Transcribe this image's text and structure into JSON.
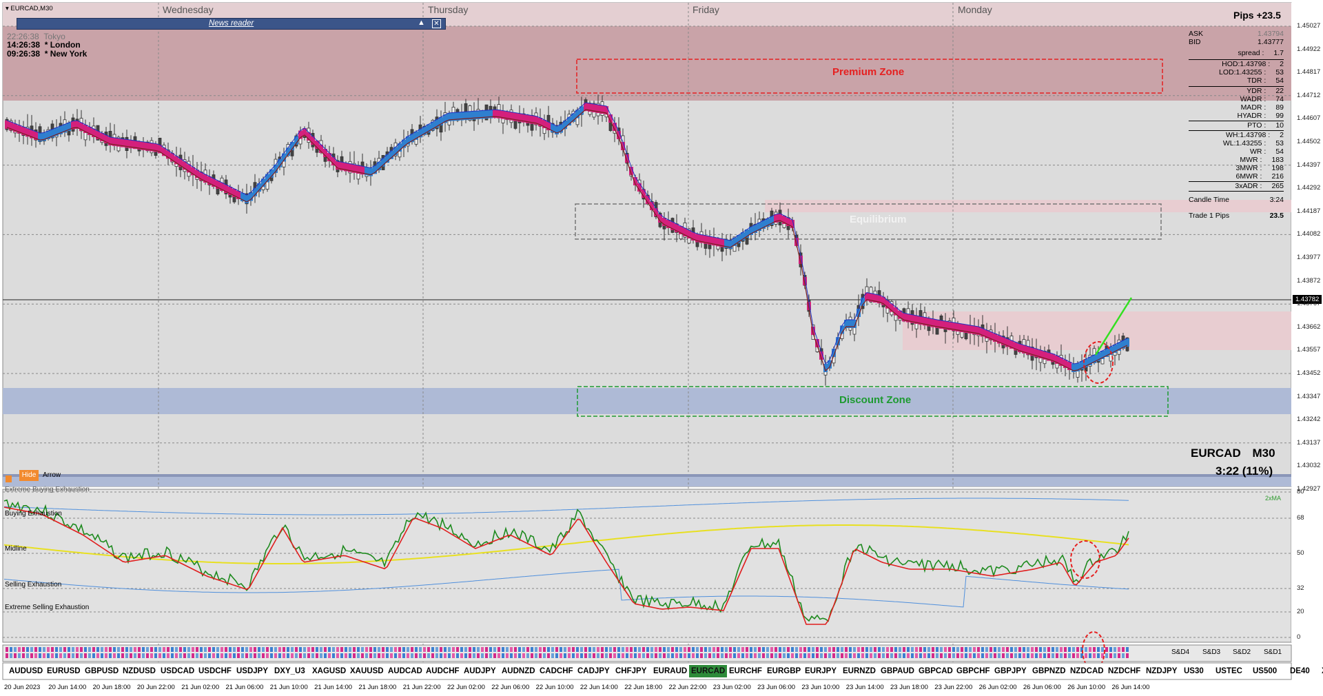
{
  "window": {
    "title": "EURCAD,M30"
  },
  "days": [
    "Wednesday",
    "Thursday",
    "Friday",
    "Monday"
  ],
  "news": {
    "title": "News reader"
  },
  "sessions": [
    {
      "time": "22:26:38",
      "name": "Tokyo"
    },
    {
      "time": "14:26:38",
      "name": "* London"
    },
    {
      "time": "09:26:38",
      "name": "* New York"
    }
  ],
  "zones": {
    "premium": "Premium Zone",
    "equilibrium": "Equilibrium",
    "discount": "Discount Zone"
  },
  "pips": "Pips +23.5",
  "panel": {
    "ask_label": "ASK",
    "ask": "1.43794",
    "bid_label": "BID",
    "bid": "1.43777",
    "spread_label": "spread :",
    "spread": "1.7",
    "hod_label": "HOD:1.43798 :",
    "hod": "2",
    "lod_label": "LOD:1.43255 :",
    "lod": "53",
    "tdr_label": "TDR :",
    "tdr": "54",
    "ydr_label": "YDR :",
    "ydr": "22",
    "wadr_label": "WADR :",
    "wadr": "74",
    "madr_label": "MADR :",
    "madr": "89",
    "hyadr_label": "HYADR :",
    "hyadr": "99",
    "pto_label": "PTO :",
    "pto": "10",
    "wh_label": "WH:1.43798 :",
    "wh": "2",
    "wl_label": "WL:1.43255 :",
    "wl": "53",
    "wr_label": "WR :",
    "wr": "54",
    "mwr_label": "MWR :",
    "mwr": "183",
    "mwr3_label": "3MWR :",
    "mwr3": "198",
    "mwr6_label": "6MWR :",
    "mwr6": "216",
    "adr3_label": "3xADR :",
    "adr3": "265",
    "candle_label": "Candle Time",
    "candle": "3:24",
    "trade_label": "Trade 1 Pips",
    "trade": "23.5"
  },
  "symbol_info": {
    "pair": "EURCAD",
    "tf": "M30",
    "timer": "3:22 (11%)"
  },
  "buttons": {
    "hide": "Hide",
    "arrow": "Arrow"
  },
  "price_axis": [
    "1.45027",
    "1.44922",
    "1.44817",
    "1.44712",
    "1.44607",
    "1.44502",
    "1.44397",
    "1.44292",
    "1.44187",
    "1.44082",
    "1.43977",
    "1.43872",
    "1.43767",
    "1.43662",
    "1.43557",
    "1.43452",
    "1.43347",
    "1.43242",
    "1.43137",
    "1.43032",
    "1.42927"
  ],
  "current_price": "1.43782",
  "oscillator": {
    "labels": [
      "Extreme Buying Exhaustion",
      "Buying Exhaustion",
      "Midline",
      "Selling Exhaustion",
      "Extreme Selling Exhaustion"
    ],
    "ma_label": "2xMA",
    "axis": [
      "80",
      "68",
      "50",
      "32",
      "20",
      "0"
    ]
  },
  "sd_labels": [
    "S&D4",
    "S&D3",
    "S&D2",
    "S&D1"
  ],
  "symbols": [
    "AUDUSD",
    "EURUSD",
    "GBPUSD",
    "NZDUSD",
    "USDCAD",
    "USDCHF",
    "USDJPY",
    "DXY_U3",
    "XAGUSD",
    "XAUUSD",
    "AUDCAD",
    "AUDCHF",
    "AUDJPY",
    "AUDNZD",
    "CADCHF",
    "CADJPY",
    "CHFJPY",
    "EURAUD",
    "EURCAD",
    "EURCHF",
    "EURGBP",
    "EURJPY",
    "EURNZD",
    "GBPAUD",
    "GBPCAD",
    "GBPCHF",
    "GBPJPY",
    "GBPNZD",
    "NZDCAD",
    "NZDCHF",
    "NZDJPY",
    "US30",
    "USTEC",
    "US500",
    "DE40",
    "XBRUSD"
  ],
  "active_symbol": "EURCAD",
  "date_axis": [
    "20 Jun 2023",
    "20 Jun 14:00",
    "20 Jun 18:00",
    "20 Jun 22:00",
    "21 Jun 02:00",
    "21 Jun 06:00",
    "21 Jun 10:00",
    "21 Jun 14:00",
    "21 Jun 18:00",
    "21 Jun 22:00",
    "22 Jun 02:00",
    "22 Jun 06:00",
    "22 Jun 10:00",
    "22 Jun 14:00",
    "22 Jun 18:00",
    "22 Jun 22:00",
    "23 Jun 02:00",
    "23 Jun 06:00",
    "23 Jun 10:00",
    "23 Jun 14:00",
    "23 Jun 18:00",
    "23 Jun 22:00",
    "26 Jun 02:00",
    "26 Jun 06:00",
    "26 Jun 10:00",
    "26 Jun 14:00"
  ]
}
